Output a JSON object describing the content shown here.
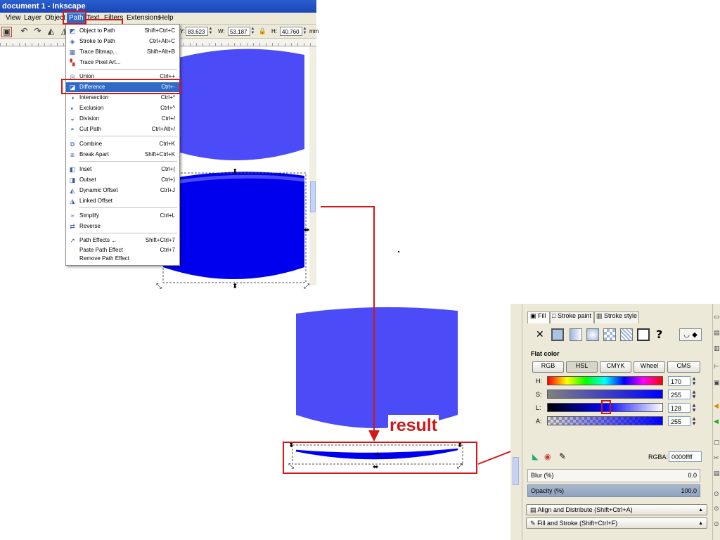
{
  "window": {
    "title": "document 1 - Inkscape"
  },
  "menubar": {
    "items": [
      "View",
      "Layer",
      "Object",
      "Path",
      "Text",
      "Filters",
      "Extensions",
      "Help"
    ],
    "active": "Path"
  },
  "toolbar": {
    "y_label": "Y:",
    "y_value": "83.623",
    "w_label": "W:",
    "w_value": "53.187",
    "h_label": "H:",
    "h_value": "40.760",
    "unit": "mm"
  },
  "path_menu": {
    "items": [
      {
        "label": "Object to Path",
        "shortcut": "Shift+Ctrl+C",
        "icon": "object-to-path-icon"
      },
      {
        "label": "Stroke to Path",
        "shortcut": "Ctrl+Alt+C",
        "icon": "stroke-to-path-icon"
      },
      {
        "label": "Trace Bitmap...",
        "shortcut": "Shift+Alt+B",
        "icon": "trace-bitmap-icon"
      },
      {
        "label": "Trace Pixel Art...",
        "shortcut": "",
        "icon": "trace-pixel-art-icon"
      },
      {
        "label": "Union",
        "shortcut": "Ctrl++",
        "icon": "union-icon"
      },
      {
        "label": "Difference",
        "shortcut": "Ctrl+-",
        "icon": "difference-icon",
        "highlighted": true
      },
      {
        "label": "Intersection",
        "shortcut": "Ctrl+*",
        "icon": "intersection-icon"
      },
      {
        "label": "Exclusion",
        "shortcut": "Ctrl+^",
        "icon": "exclusion-icon"
      },
      {
        "label": "Division",
        "shortcut": "Ctrl+/",
        "icon": "division-icon"
      },
      {
        "label": "Cut Path",
        "shortcut": "Ctrl+Alt+/",
        "icon": "cut-path-icon"
      },
      {
        "label": "Combine",
        "shortcut": "Ctrl+K",
        "icon": "combine-icon"
      },
      {
        "label": "Break Apart",
        "shortcut": "Shift+Ctrl+K",
        "icon": "break-apart-icon"
      },
      {
        "label": "Inset",
        "shortcut": "Ctrl+(",
        "icon": "inset-icon"
      },
      {
        "label": "Outset",
        "shortcut": "Ctrl+)",
        "icon": "outset-icon"
      },
      {
        "label": "Dynamic Offset",
        "shortcut": "Ctrl+J",
        "icon": "dynamic-offset-icon"
      },
      {
        "label": "Linked Offset",
        "shortcut": "",
        "icon": "linked-offset-icon"
      },
      {
        "label": "Simplify",
        "shortcut": "Ctrl+L",
        "icon": "simplify-icon"
      },
      {
        "label": "Reverse",
        "shortcut": "",
        "icon": "reverse-icon"
      },
      {
        "label": "Path Effects ...",
        "shortcut": "Shift+Ctrl+7",
        "icon": "path-effects-icon"
      },
      {
        "label": "Paste Path Effect",
        "shortcut": "Ctrl+7",
        "icon": ""
      },
      {
        "label": "Remove Path Effect",
        "shortcut": "",
        "icon": ""
      }
    ]
  },
  "annotation": {
    "result_label": "result"
  },
  "fill_stroke": {
    "tabs": [
      "Fill",
      "Stroke paint",
      "Stroke style"
    ],
    "flat_color_label": "Flat color",
    "modes": [
      "RGB",
      "HSL",
      "CMYK",
      "Wheel",
      "CMS"
    ],
    "active_mode": "HSL",
    "sliders": [
      {
        "label": "H:",
        "value": "170"
      },
      {
        "label": "S:",
        "value": "255"
      },
      {
        "label": "L:",
        "value": "128"
      },
      {
        "label": "A:",
        "value": "255"
      }
    ],
    "rgba_label": "RGBA:",
    "rgba_value": "0000ffff",
    "blur_label": "Blur (%)",
    "blur_value": "0.0",
    "opacity_label": "Opacity (%)",
    "opacity_value": "100.0",
    "dock_items": [
      "Align and Distribute (Shift+Ctrl+A)",
      "Fill and Stroke (Shift+Ctrl+F)"
    ]
  },
  "colors": {
    "light_blue": "#4b4bf7",
    "dark_blue": "#0000ee",
    "annotation_red": "#d01818",
    "menu_highlight": "#316ac5"
  }
}
